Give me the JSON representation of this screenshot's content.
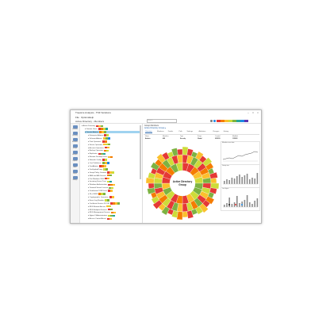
{
  "window": {
    "title": "Treesize Analysis - TNF Solutions"
  },
  "menu": [
    "File",
    "Options",
    "Help"
  ],
  "toolbar": {
    "scan_label": "Active Directory - Members",
    "search_placeholder": "Search"
  },
  "legend_colors": [
    "#e53935",
    "#f57c00",
    "#fbc02d",
    "#cddc39",
    "#7cb342",
    "#26a69a",
    "#1e88e5",
    "#5e35b1"
  ],
  "nav": [
    {
      "label": "Overview",
      "icon": "overview-icon"
    },
    {
      "label": "Directory",
      "icon": "directory-icon"
    },
    {
      "label": "Accounts",
      "icon": "accounts-icon"
    },
    {
      "label": "Groups",
      "icon": "groups-icon"
    },
    {
      "label": "Analysis",
      "icon": "analysis-icon"
    },
    {
      "label": "Reports",
      "icon": "reports-icon"
    },
    {
      "label": "Audit",
      "icon": "audit-icon"
    },
    {
      "label": "Export",
      "icon": "export-icon"
    },
    {
      "label": "Settings",
      "icon": "settings-icon"
    }
  ],
  "tree_rows": [
    {
      "label": "Active Directory",
      "depth": 0,
      "segs": [
        "#e53935",
        "#fbc02d",
        "#7cb342"
      ]
    },
    {
      "label": "Domain Users",
      "depth": 1,
      "segs": [
        "#e53935",
        "#f57c00",
        "#cddc39",
        "#26a69a"
      ]
    },
    {
      "label": "Domain Admins",
      "depth": 1,
      "segs": [
        "#f57c00",
        "#fbc02d",
        "#7cb342"
      ],
      "selected": true
    },
    {
      "label": "Enterprise Admins",
      "depth": 2,
      "segs": [
        "#e53935",
        "#cddc39"
      ]
    },
    {
      "label": "Schema Admins",
      "depth": 2,
      "segs": [
        "#fbc02d",
        "#7cb342",
        "#1e88e5"
      ]
    },
    {
      "label": "Print Operators",
      "depth": 2,
      "segs": [
        "#e53935",
        "#f57c00"
      ]
    },
    {
      "label": "Server Operators",
      "depth": 2,
      "segs": [
        "#fbc02d",
        "#cddc39",
        "#7cb342"
      ]
    },
    {
      "label": "Account Operators",
      "depth": 2,
      "segs": [
        "#e53935",
        "#fbc02d"
      ]
    },
    {
      "label": "Backup Operators",
      "depth": 2,
      "segs": [
        "#f57c00",
        "#cddc39"
      ]
    },
    {
      "label": "Replicator",
      "depth": 2,
      "segs": [
        "#e53935",
        "#7cb342",
        "#26a69a"
      ]
    },
    {
      "label": "Remote Desktop Users",
      "depth": 2,
      "segs": [
        "#fbc02d",
        "#f57c00"
      ]
    },
    {
      "label": "Network Config",
      "depth": 2,
      "segs": [
        "#e53935",
        "#cddc39"
      ]
    },
    {
      "label": "Cert Publishers",
      "depth": 2,
      "segs": [
        "#7cb342",
        "#fbc02d",
        "#1e88e5"
      ]
    },
    {
      "label": "DnsAdmins",
      "depth": 2,
      "segs": [
        "#e53935",
        "#f57c00",
        "#fbc02d"
      ]
    },
    {
      "label": "DnsUpdateProxy",
      "depth": 2,
      "segs": [
        "#cddc39",
        "#7cb342"
      ]
    },
    {
      "label": "Group Policy Creators",
      "depth": 2,
      "segs": [
        "#e53935",
        "#fbc02d",
        "#cddc39"
      ]
    },
    {
      "label": "RAS and IAS Servers",
      "depth": 2,
      "segs": [
        "#f57c00",
        "#7cb342"
      ]
    },
    {
      "label": "Pre-Windows 2000",
      "depth": 2,
      "segs": [
        "#e53935",
        "#fbc02d"
      ]
    },
    {
      "label": "Incoming Forest Trust",
      "depth": 2,
      "segs": [
        "#cddc39",
        "#26a69a"
      ]
    },
    {
      "label": "Windows Authorization",
      "depth": 2,
      "segs": [
        "#e53935",
        "#f57c00",
        "#fbc02d"
      ]
    },
    {
      "label": "Terminal Server License",
      "depth": 2,
      "segs": [
        "#7cb342",
        "#cddc39"
      ]
    },
    {
      "label": "Distributed COM Users",
      "depth": 2,
      "segs": [
        "#e53935",
        "#fbc02d"
      ]
    },
    {
      "label": "IIS_IUSRS",
      "depth": 2,
      "segs": [
        "#f57c00",
        "#cddc39",
        "#7cb342"
      ]
    },
    {
      "label": "Cryptographic Operators",
      "depth": 2,
      "segs": [
        "#e53935",
        "#fbc02d"
      ]
    },
    {
      "label": "Event Log Readers",
      "depth": 2,
      "segs": [
        "#cddc39",
        "#7cb342"
      ]
    },
    {
      "label": "Certificate Service DCOM",
      "depth": 2,
      "segs": [
        "#e53935",
        "#f57c00",
        "#fbc02d",
        "#7cb342"
      ]
    },
    {
      "label": "RDS Remote Access",
      "depth": 2,
      "segs": [
        "#fbc02d",
        "#cddc39"
      ]
    },
    {
      "label": "RDS Endpoint Servers",
      "depth": 2,
      "segs": [
        "#e53935",
        "#7cb342"
      ]
    },
    {
      "label": "RDS Management Servers",
      "depth": 2,
      "segs": [
        "#f57c00",
        "#fbc02d"
      ]
    },
    {
      "label": "Hyper-V Administrators",
      "depth": 2,
      "segs": [
        "#cddc39",
        "#7cb342",
        "#26a69a"
      ]
    },
    {
      "label": "Access Control Assist",
      "depth": 2,
      "segs": [
        "#e53935",
        "#fbc02d"
      ]
    }
  ],
  "main": {
    "header": "Group Members",
    "breadcrumb": "Active Directory Group ▸",
    "tabs": [
      "Overview",
      "Members",
      "Details",
      "Path",
      "Settings",
      "Attributes",
      "Changes",
      "History"
    ],
    "info": [
      {
        "label": "Name",
        "value": "Admins"
      },
      {
        "label": "Members",
        "value": "428"
      },
      {
        "label": "Type",
        "value": "Security"
      },
      {
        "label": "Scope",
        "value": "Global"
      },
      {
        "label": "Created",
        "value": "03/2019"
      },
      {
        "label": "Modified",
        "value": "11/2023"
      }
    ],
    "center_label_1": "Active Directory",
    "center_label_2": "Group"
  },
  "graphs": [
    {
      "title": "Members over time"
    },
    {
      "title": "Group size"
    },
    {
      "title": "Last logon"
    }
  ],
  "sunburst": {
    "ring1": [
      "#e53935",
      "#e53935",
      "#f57c00",
      "#fbc02d",
      "#cddc39",
      "#7cb342",
      "#7cb342",
      "#cddc39",
      "#fbc02d",
      "#e53935",
      "#f57c00",
      "#e53935",
      "#cddc39",
      "#7cb342",
      "#fbc02d",
      "#e53935",
      "#e53935",
      "#f57c00",
      "#7cb342",
      "#cddc39"
    ],
    "ring2": [
      "#e53935",
      "#fbc02d",
      "#7cb342",
      "#cddc39",
      "#e53935",
      "#f57c00",
      "#fbc02d",
      "#7cb342",
      "#e53935",
      "#cddc39",
      "#fbc02d",
      "#e53935",
      "#7cb342",
      "#f57c00",
      "#cddc39",
      "#e53935",
      "#fbc02d",
      "#7cb342",
      "#e53935",
      "#cddc39",
      "#f57c00",
      "#fbc02d",
      "#e53935",
      "#7cb342",
      "#cddc39",
      "#fbc02d",
      "#e53935",
      "#f57c00",
      "#7cb342",
      "#cddc39",
      "#e53935",
      "#fbc02d"
    ],
    "ring3": [
      "#cddc39",
      "#e53935",
      "#7cb342",
      "#fbc02d",
      "#e53935",
      "#cddc39",
      "#f57c00",
      "#7cb342",
      "#e53935",
      "#fbc02d",
      "#cddc39",
      "#e53935",
      "#7cb342",
      "#f57c00",
      "#e53935",
      "#fbc02d",
      "#cddc39",
      "#7cb342",
      "#e53935",
      "#fbc02d",
      "#f57c00",
      "#cddc39",
      "#e53935",
      "#7cb342",
      "#fbc02d",
      "#e53935",
      "#cddc39",
      "#f57c00",
      "#7cb342",
      "#e53935",
      "#fbc02d",
      "#cddc39",
      "#e53935",
      "#7cb342",
      "#f57c00",
      "#fbc02d",
      "#e53935",
      "#cddc39",
      "#7cb342",
      "#e53935"
    ]
  }
}
